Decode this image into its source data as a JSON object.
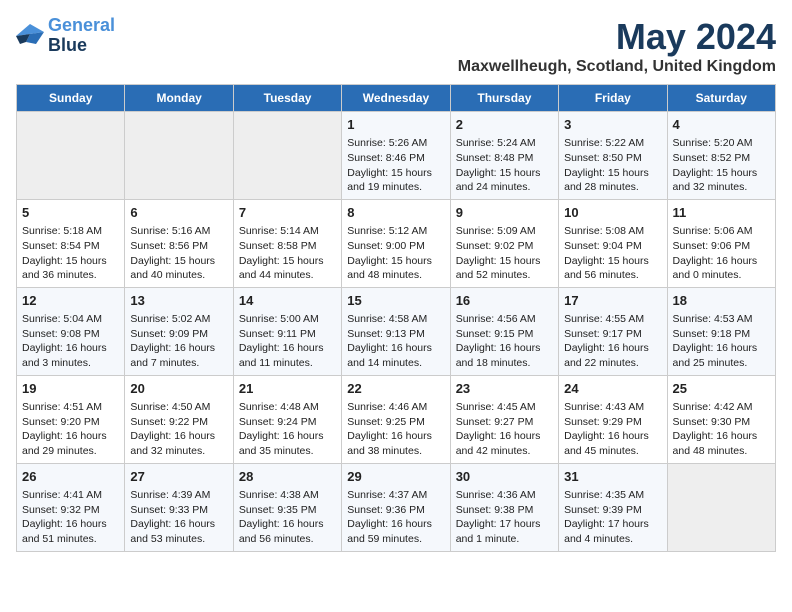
{
  "logo": {
    "line1": "General",
    "line2": "Blue"
  },
  "title": "May 2024",
  "subtitle": "Maxwellheugh, Scotland, United Kingdom",
  "days_header": [
    "Sunday",
    "Monday",
    "Tuesday",
    "Wednesday",
    "Thursday",
    "Friday",
    "Saturday"
  ],
  "weeks": [
    [
      {
        "day": "",
        "content": ""
      },
      {
        "day": "",
        "content": ""
      },
      {
        "day": "",
        "content": ""
      },
      {
        "day": "1",
        "content": "Sunrise: 5:26 AM\nSunset: 8:46 PM\nDaylight: 15 hours\nand 19 minutes."
      },
      {
        "day": "2",
        "content": "Sunrise: 5:24 AM\nSunset: 8:48 PM\nDaylight: 15 hours\nand 24 minutes."
      },
      {
        "day": "3",
        "content": "Sunrise: 5:22 AM\nSunset: 8:50 PM\nDaylight: 15 hours\nand 28 minutes."
      },
      {
        "day": "4",
        "content": "Sunrise: 5:20 AM\nSunset: 8:52 PM\nDaylight: 15 hours\nand 32 minutes."
      }
    ],
    [
      {
        "day": "5",
        "content": "Sunrise: 5:18 AM\nSunset: 8:54 PM\nDaylight: 15 hours\nand 36 minutes."
      },
      {
        "day": "6",
        "content": "Sunrise: 5:16 AM\nSunset: 8:56 PM\nDaylight: 15 hours\nand 40 minutes."
      },
      {
        "day": "7",
        "content": "Sunrise: 5:14 AM\nSunset: 8:58 PM\nDaylight: 15 hours\nand 44 minutes."
      },
      {
        "day": "8",
        "content": "Sunrise: 5:12 AM\nSunset: 9:00 PM\nDaylight: 15 hours\nand 48 minutes."
      },
      {
        "day": "9",
        "content": "Sunrise: 5:09 AM\nSunset: 9:02 PM\nDaylight: 15 hours\nand 52 minutes."
      },
      {
        "day": "10",
        "content": "Sunrise: 5:08 AM\nSunset: 9:04 PM\nDaylight: 15 hours\nand 56 minutes."
      },
      {
        "day": "11",
        "content": "Sunrise: 5:06 AM\nSunset: 9:06 PM\nDaylight: 16 hours\nand 0 minutes."
      }
    ],
    [
      {
        "day": "12",
        "content": "Sunrise: 5:04 AM\nSunset: 9:08 PM\nDaylight: 16 hours\nand 3 minutes."
      },
      {
        "day": "13",
        "content": "Sunrise: 5:02 AM\nSunset: 9:09 PM\nDaylight: 16 hours\nand 7 minutes."
      },
      {
        "day": "14",
        "content": "Sunrise: 5:00 AM\nSunset: 9:11 PM\nDaylight: 16 hours\nand 11 minutes."
      },
      {
        "day": "15",
        "content": "Sunrise: 4:58 AM\nSunset: 9:13 PM\nDaylight: 16 hours\nand 14 minutes."
      },
      {
        "day": "16",
        "content": "Sunrise: 4:56 AM\nSunset: 9:15 PM\nDaylight: 16 hours\nand 18 minutes."
      },
      {
        "day": "17",
        "content": "Sunrise: 4:55 AM\nSunset: 9:17 PM\nDaylight: 16 hours\nand 22 minutes."
      },
      {
        "day": "18",
        "content": "Sunrise: 4:53 AM\nSunset: 9:18 PM\nDaylight: 16 hours\nand 25 minutes."
      }
    ],
    [
      {
        "day": "19",
        "content": "Sunrise: 4:51 AM\nSunset: 9:20 PM\nDaylight: 16 hours\nand 29 minutes."
      },
      {
        "day": "20",
        "content": "Sunrise: 4:50 AM\nSunset: 9:22 PM\nDaylight: 16 hours\nand 32 minutes."
      },
      {
        "day": "21",
        "content": "Sunrise: 4:48 AM\nSunset: 9:24 PM\nDaylight: 16 hours\nand 35 minutes."
      },
      {
        "day": "22",
        "content": "Sunrise: 4:46 AM\nSunset: 9:25 PM\nDaylight: 16 hours\nand 38 minutes."
      },
      {
        "day": "23",
        "content": "Sunrise: 4:45 AM\nSunset: 9:27 PM\nDaylight: 16 hours\nand 42 minutes."
      },
      {
        "day": "24",
        "content": "Sunrise: 4:43 AM\nSunset: 9:29 PM\nDaylight: 16 hours\nand 45 minutes."
      },
      {
        "day": "25",
        "content": "Sunrise: 4:42 AM\nSunset: 9:30 PM\nDaylight: 16 hours\nand 48 minutes."
      }
    ],
    [
      {
        "day": "26",
        "content": "Sunrise: 4:41 AM\nSunset: 9:32 PM\nDaylight: 16 hours\nand 51 minutes."
      },
      {
        "day": "27",
        "content": "Sunrise: 4:39 AM\nSunset: 9:33 PM\nDaylight: 16 hours\nand 53 minutes."
      },
      {
        "day": "28",
        "content": "Sunrise: 4:38 AM\nSunset: 9:35 PM\nDaylight: 16 hours\nand 56 minutes."
      },
      {
        "day": "29",
        "content": "Sunrise: 4:37 AM\nSunset: 9:36 PM\nDaylight: 16 hours\nand 59 minutes."
      },
      {
        "day": "30",
        "content": "Sunrise: 4:36 AM\nSunset: 9:38 PM\nDaylight: 17 hours\nand 1 minute."
      },
      {
        "day": "31",
        "content": "Sunrise: 4:35 AM\nSunset: 9:39 PM\nDaylight: 17 hours\nand 4 minutes."
      },
      {
        "day": "",
        "content": ""
      }
    ]
  ]
}
